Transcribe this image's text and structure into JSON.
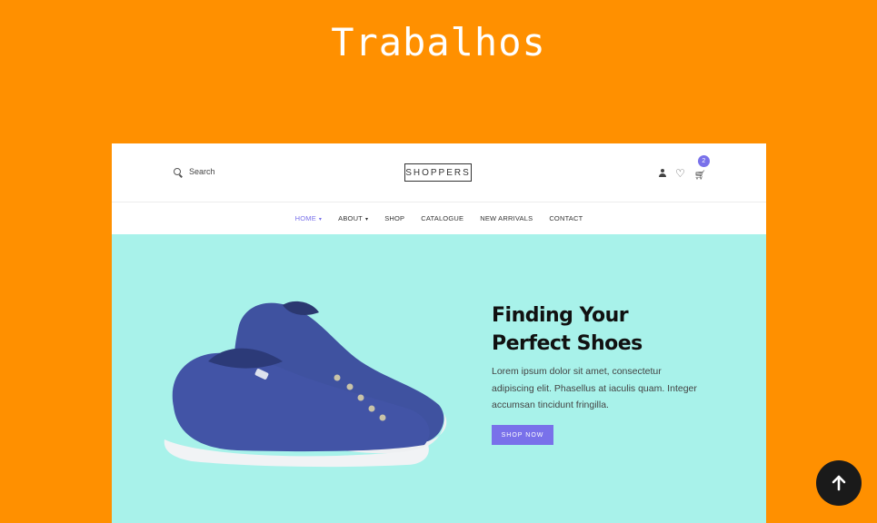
{
  "section": {
    "title": "Trabalhos"
  },
  "preview": {
    "search": {
      "placeholder": "Search",
      "icon": "search-icon"
    },
    "logo": "SHOPPERS",
    "cart": {
      "count": "2"
    },
    "nav": [
      {
        "label": "HOME",
        "has_dropdown": true,
        "active": true
      },
      {
        "label": "ABOUT",
        "has_dropdown": true,
        "active": false
      },
      {
        "label": "SHOP",
        "has_dropdown": false,
        "active": false
      },
      {
        "label": "CATALOGUE",
        "has_dropdown": false,
        "active": false
      },
      {
        "label": "NEW ARRIVALS",
        "has_dropdown": false,
        "active": false
      },
      {
        "label": "CONTACT",
        "has_dropdown": false,
        "active": false
      }
    ],
    "hero": {
      "title_line1": "Finding Your",
      "title_line2": "Perfect Shoes",
      "text": "Lorem ipsum dolor sit amet, consectetur adipiscing elit. Phasellus at iaculis quam. Integer accumsan tincidunt fringilla.",
      "button": "SHOP NOW"
    }
  },
  "colors": {
    "background": "#ff9000",
    "accent": "#7971ea",
    "hero_bg": "#a8f2ea"
  }
}
